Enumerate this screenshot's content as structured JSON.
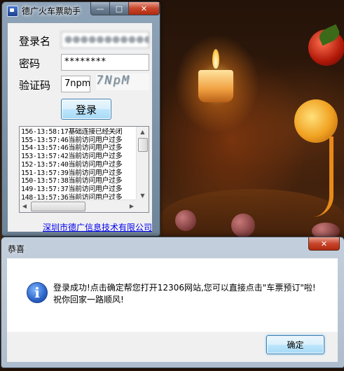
{
  "app": {
    "title": "德广火车票助手",
    "username_label": "登录名",
    "username_value": "●●●●●●●●●●●",
    "password_label": "密码",
    "password_value": "********",
    "captcha_label": "验证码",
    "captcha_value": "7npm",
    "captcha_image_text": "7NpM",
    "login_button": "登录",
    "log_lines": [
      "156-13:58:17基础连接已经关闭",
      "155-13:57:46当前访问用户过多",
      "154-13:57:46当前访问用户过多",
      "153-13:57:42当前访问用户过多",
      "152-13:57:40当前访问用户过多",
      "151-13:57:39当前访问用户过多",
      "150-13:57:38当前访问用户过多",
      "149-13:57:37当前访问用户过多",
      "148-13:57:36当前访问用户过多"
    ],
    "company_link": "深圳市德广信息技术有限公司"
  },
  "caption_buttons": {
    "minimize": "—",
    "maximize": "□",
    "close": "✕"
  },
  "dialog": {
    "title": "恭喜",
    "message_line1": "登录成功!点击确定帮您打开12306网站,您可以直接点击\"车票预订\"啦!",
    "message_line2": "祝你回家一路顺风!",
    "ok_button": "确定",
    "close": "✕",
    "info_glyph": "i"
  },
  "scroll_arrows": {
    "up": "▲",
    "down": "▼",
    "left": "◀",
    "right": "▶"
  }
}
